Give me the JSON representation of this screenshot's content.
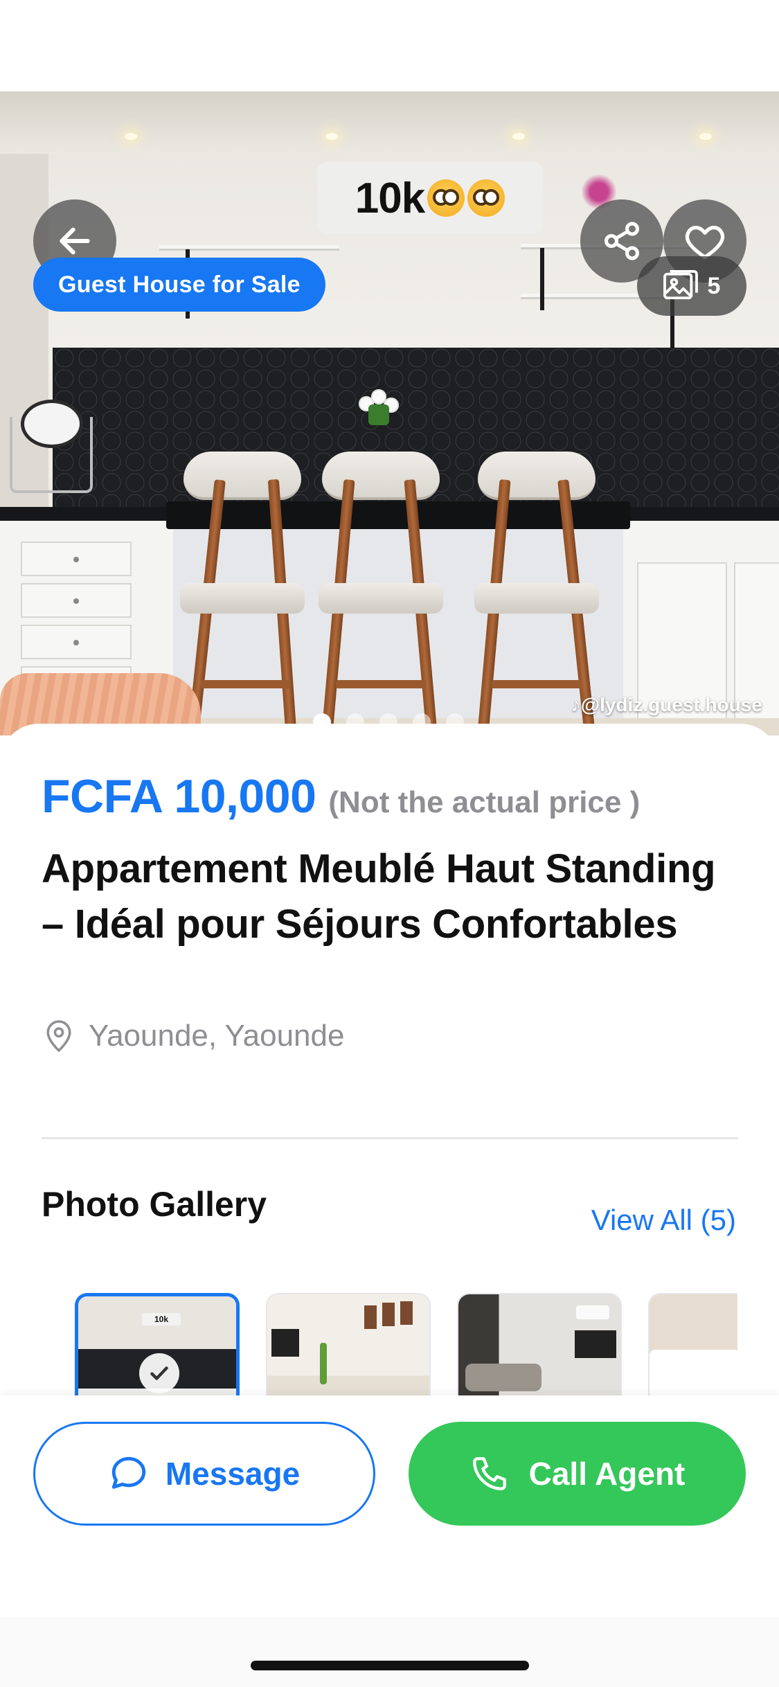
{
  "listing": {
    "type_badge": "Guest House for Sale",
    "photo_count": "5",
    "watermark": "@lydiz.guest.house",
    "image_sign_text": "10k",
    "price": "FCFA 10,000",
    "price_note": "(Not the actual price )",
    "title": "Appartement Meublé Haut Standing – Idéal pour Séjours Confortables",
    "location": "Yaounde, Yaounde"
  },
  "carousel": {
    "total_dots": 5,
    "active_index": 0
  },
  "gallery": {
    "title": "Photo Gallery",
    "view_all_label": "View All (5)",
    "thumbs_visible": 4,
    "selected_index": 0
  },
  "actions": {
    "message_label": "Message",
    "call_label": "Call Agent"
  },
  "icons": {
    "back": "arrow-left-icon",
    "share": "share-icon",
    "favorite": "heart-icon",
    "photos": "image-icon",
    "location": "map-pin-icon",
    "message": "chat-bubble-icon",
    "call": "phone-icon",
    "check": "checkmark-icon"
  },
  "colors": {
    "accent": "#1877f2",
    "call_green": "#34c759",
    "muted": "#8e8e93"
  }
}
